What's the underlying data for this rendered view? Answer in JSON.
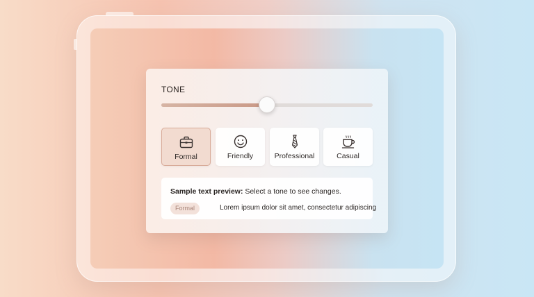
{
  "tone": {
    "label": "TONE",
    "slider_value": 0.5,
    "options": [
      {
        "label": "Formal",
        "icon": "briefcase-icon",
        "selected": true
      },
      {
        "label": "Friendly",
        "icon": "smiley-icon",
        "selected": false
      },
      {
        "label": "Professional",
        "icon": "necktie-icon",
        "selected": false
      },
      {
        "label": "Casual",
        "icon": "coffee-cup-icon",
        "selected": false
      }
    ]
  },
  "preview": {
    "heading_bold": "Sample text preview:",
    "heading_rest": " Select a tone to see changes.",
    "badge": "Formal",
    "body": "Lorem ipsum dolor sit amet, consectetur adipiscing"
  },
  "colors": {
    "accent": "#d6ab98",
    "selected_bg": "#f2dbd0",
    "badge_text": "#a9867a"
  }
}
